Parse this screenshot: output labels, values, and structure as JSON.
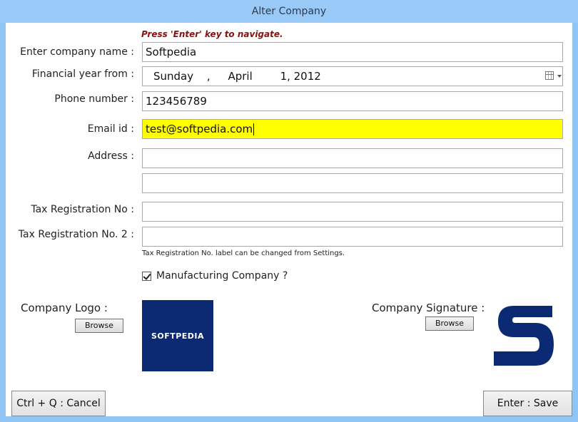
{
  "window": {
    "title": "Alter Company"
  },
  "hint": "Press 'Enter' key to navigate.",
  "labels": {
    "company_name": "Enter company name :",
    "financial_year": "Financial year from :",
    "phone": "Phone number :",
    "email": "Email id :",
    "address": "Address :",
    "tax1": "Tax Registration No :",
    "tax2": "Tax Registration No. 2 :",
    "company_logo": "Company Logo :",
    "company_signature": "Company Signature :"
  },
  "fields": {
    "company_name": "Softpedia",
    "financial_year": {
      "weekday": "Sunday",
      "sep": ",",
      "month": "April",
      "day_year": "1, 2012"
    },
    "phone": "123456789",
    "email": "test@softpedia.com",
    "address_line1": "",
    "address_line2": "",
    "tax1": "",
    "tax2": ""
  },
  "tax_note": "Tax Registration No. label can be changed from Settings.",
  "manufacturing": {
    "label": "Manufacturing Company ?",
    "checked": true
  },
  "logo": {
    "text": "SOFTPEDIA",
    "bg": "#0b2a73"
  },
  "buttons": {
    "browse_logo": "Browse",
    "browse_signature": "Browse",
    "cancel": "Ctrl + Q : Cancel",
    "save": "Enter : Save"
  },
  "colors": {
    "active_field": "#ffff00",
    "hint": "#8b1010",
    "titlebar": "#99c9f6"
  },
  "icons": {
    "date_picker": "calendar-icon",
    "check": "checkmark-icon"
  }
}
